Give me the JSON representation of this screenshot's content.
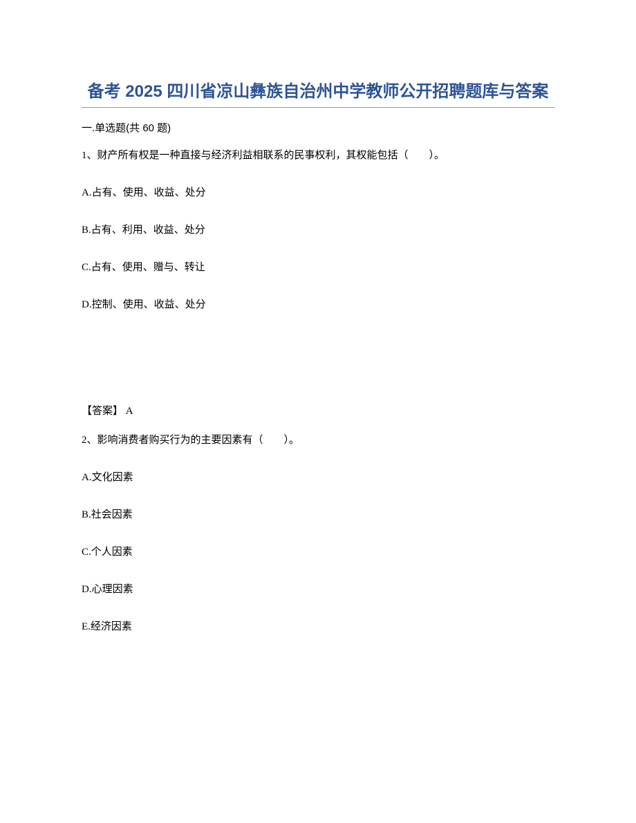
{
  "title": "备考 2025 四川省凉山彝族自治州中学教师公开招聘题库与答案",
  "sectionHeader": "一.单选题(共 60 题)",
  "question1": {
    "text": "1、财产所有权是一种直接与经济利益相联系的民事权利，其权能包括（　　）。",
    "options": {
      "A": "A.占有、使用、收益、处分",
      "B": "B.占有、利用、收益、处分",
      "C": "C.占有、使用、赠与、转让",
      "D": "D.控制、使用、收益、处分"
    },
    "answer": "【答案】 A"
  },
  "question2": {
    "text": "2、影响消费者购买行为的主要因素有（　　）。",
    "options": {
      "A": "A.文化因素",
      "B": "B.社会因素",
      "C": "C.个人因素",
      "D": "D.心理因素",
      "E": "E.经济因素"
    }
  }
}
